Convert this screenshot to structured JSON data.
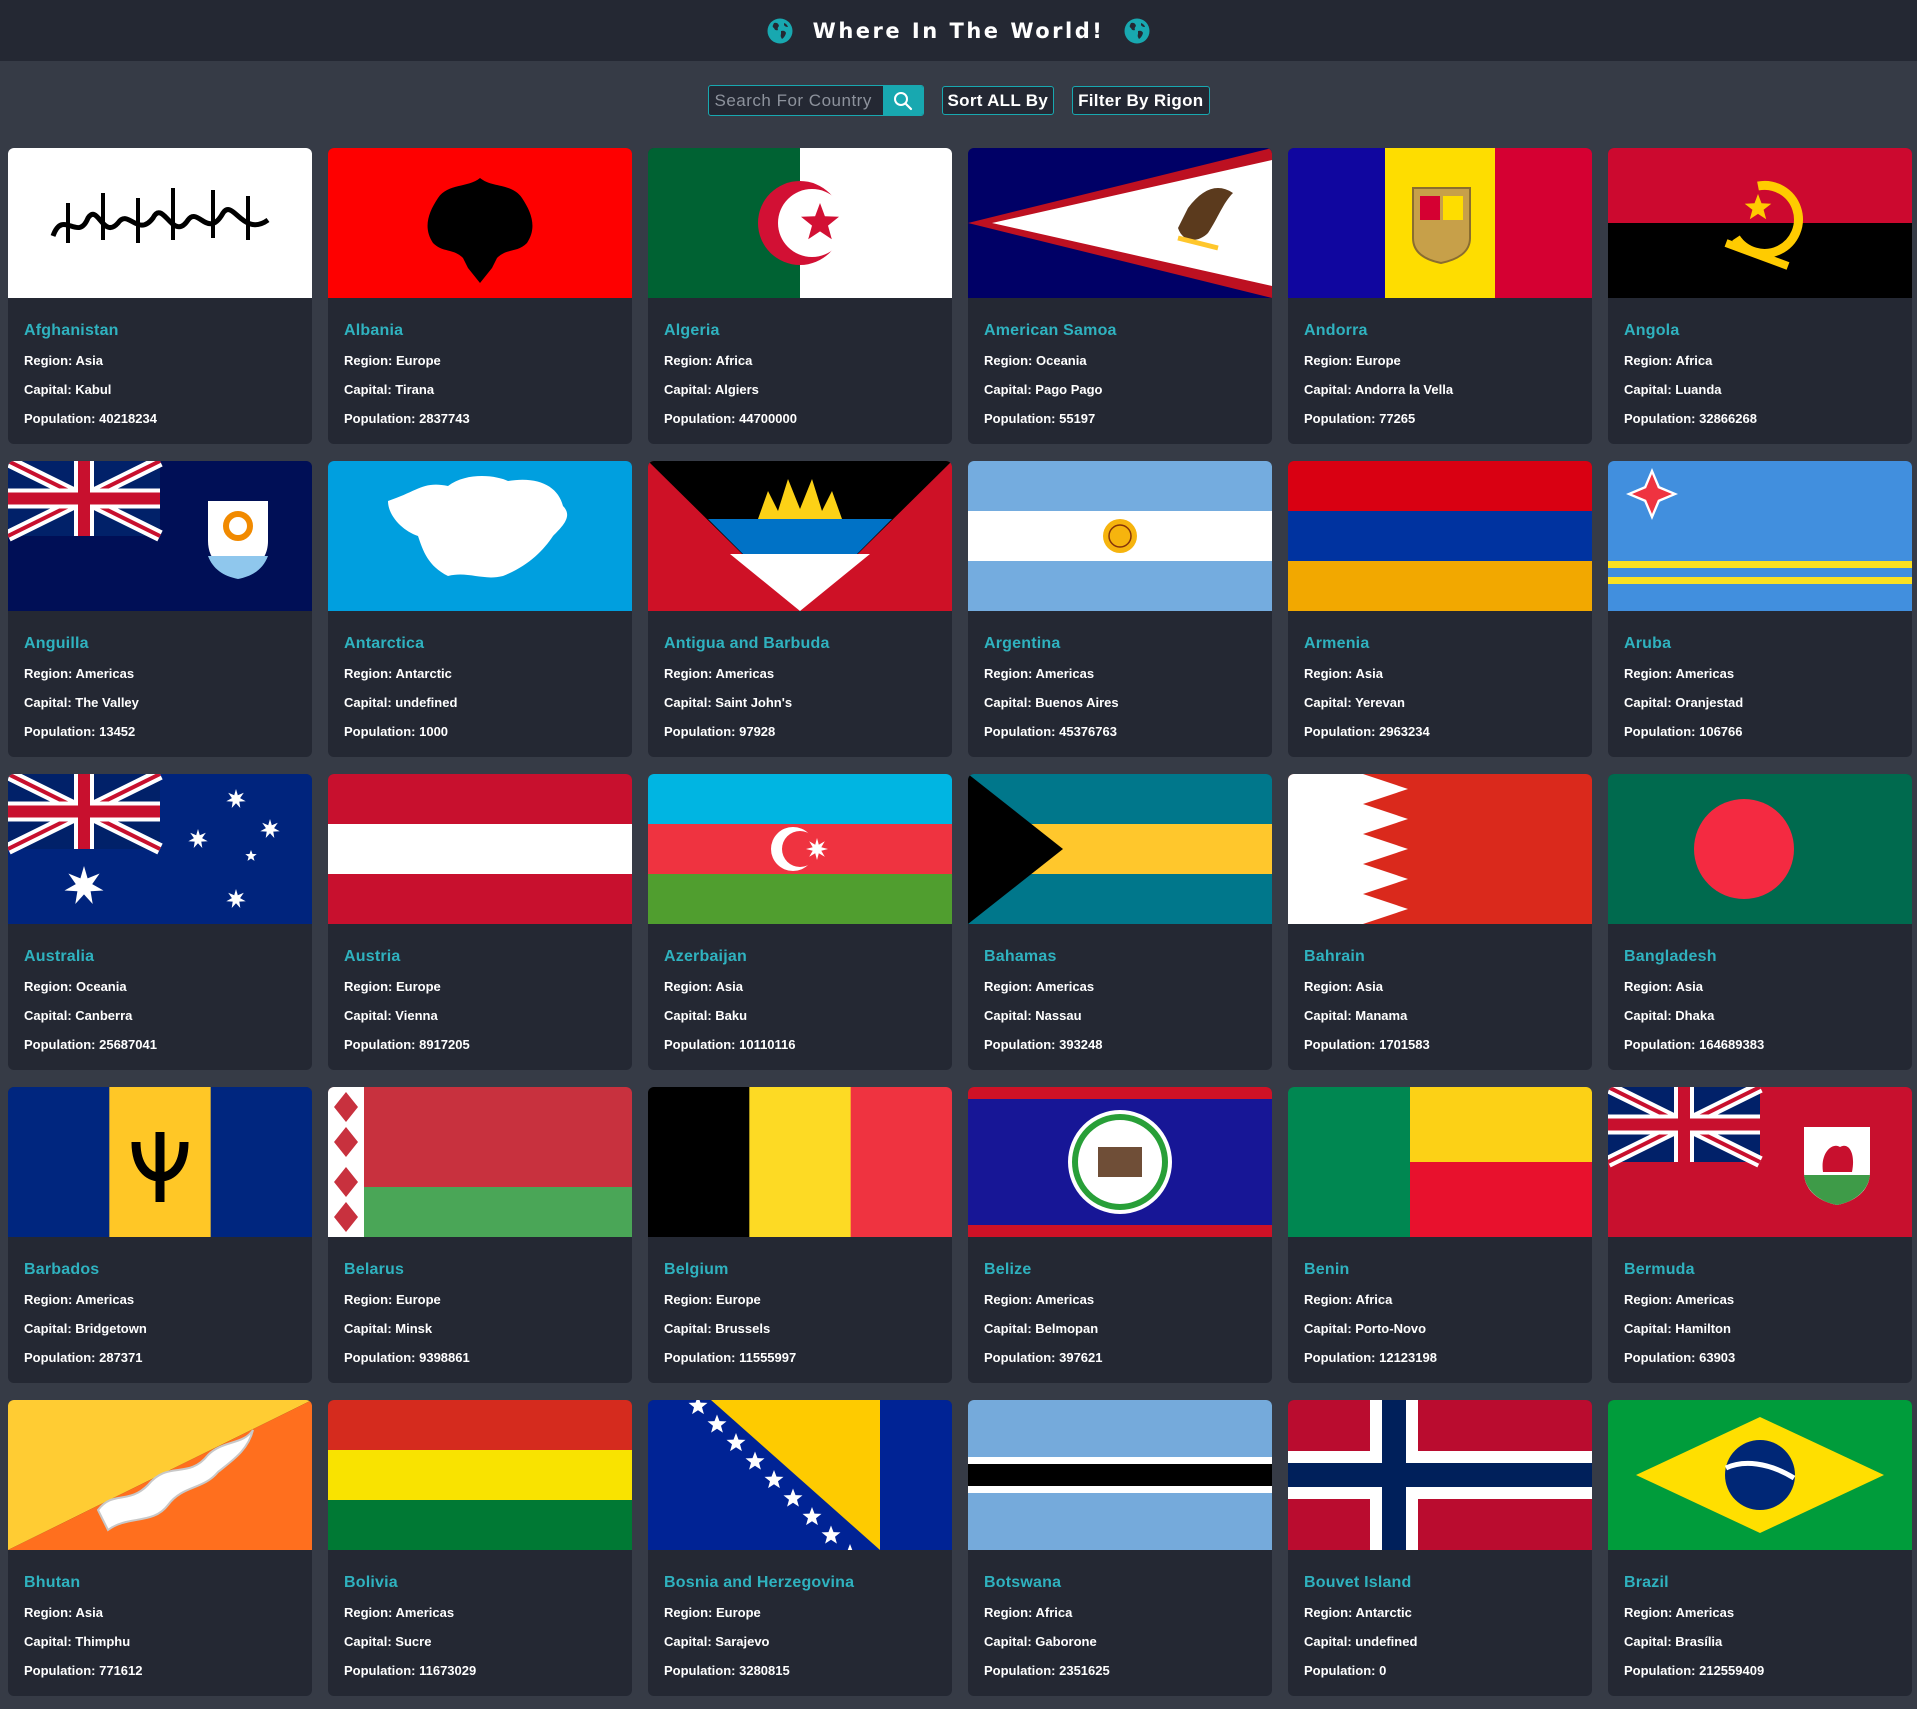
{
  "header": {
    "title": "Where In The World!"
  },
  "controls": {
    "search_placeholder": "Search For Country",
    "sort_label": "Sort ALL By",
    "filter_label": "Filter By Rigon"
  },
  "labels": {
    "region": "Region: ",
    "capital": "Capital: ",
    "population": "Population: "
  },
  "countries": [
    {
      "name": "Afghanistan",
      "region": "Asia",
      "capital": "Kabul",
      "population": "40218234",
      "flag": "afghanistan-flag"
    },
    {
      "name": "Albania",
      "region": "Europe",
      "capital": "Tirana",
      "population": "2837743",
      "flag": "albania-flag"
    },
    {
      "name": "Algeria",
      "region": "Africa",
      "capital": "Algiers",
      "population": "44700000",
      "flag": "algeria-flag"
    },
    {
      "name": "American Samoa",
      "region": "Oceania",
      "capital": "Pago Pago",
      "population": "55197",
      "flag": "american-samoa-flag"
    },
    {
      "name": "Andorra",
      "region": "Europe",
      "capital": "Andorra la Vella",
      "population": "77265",
      "flag": "andorra-flag"
    },
    {
      "name": "Angola",
      "region": "Africa",
      "capital": "Luanda",
      "population": "32866268",
      "flag": "angola-flag"
    },
    {
      "name": "Anguilla",
      "region": "Americas",
      "capital": "The Valley",
      "population": "13452",
      "flag": "anguilla-flag"
    },
    {
      "name": "Antarctica",
      "region": "Antarctic",
      "capital": "undefined",
      "population": "1000",
      "flag": "antarctica-flag"
    },
    {
      "name": "Antigua and Barbuda",
      "region": "Americas",
      "capital": "Saint John's",
      "population": "97928",
      "flag": "antigua-and-barbuda-flag"
    },
    {
      "name": "Argentina",
      "region": "Americas",
      "capital": "Buenos Aires",
      "population": "45376763",
      "flag": "argentina-flag"
    },
    {
      "name": "Armenia",
      "region": "Asia",
      "capital": "Yerevan",
      "population": "2963234",
      "flag": "armenia-flag"
    },
    {
      "name": "Aruba",
      "region": "Americas",
      "capital": "Oranjestad",
      "population": "106766",
      "flag": "aruba-flag"
    },
    {
      "name": "Australia",
      "region": "Oceania",
      "capital": "Canberra",
      "population": "25687041",
      "flag": "australia-flag"
    },
    {
      "name": "Austria",
      "region": "Europe",
      "capital": "Vienna",
      "population": "8917205",
      "flag": "austria-flag"
    },
    {
      "name": "Azerbaijan",
      "region": "Asia",
      "capital": "Baku",
      "population": "10110116",
      "flag": "azerbaijan-flag"
    },
    {
      "name": "Bahamas",
      "region": "Americas",
      "capital": "Nassau",
      "population": "393248",
      "flag": "bahamas-flag"
    },
    {
      "name": "Bahrain",
      "region": "Asia",
      "capital": "Manama",
      "population": "1701583",
      "flag": "bahrain-flag"
    },
    {
      "name": "Bangladesh",
      "region": "Asia",
      "capital": "Dhaka",
      "population": "164689383",
      "flag": "bangladesh-flag"
    },
    {
      "name": "Barbados",
      "region": "Americas",
      "capital": "Bridgetown",
      "population": "287371",
      "flag": "barbados-flag"
    },
    {
      "name": "Belarus",
      "region": "Europe",
      "capital": "Minsk",
      "population": "9398861",
      "flag": "belarus-flag"
    },
    {
      "name": "Belgium",
      "region": "Europe",
      "capital": "Brussels",
      "population": "11555997",
      "flag": "belgium-flag"
    },
    {
      "name": "Belize",
      "region": "Americas",
      "capital": "Belmopan",
      "population": "397621",
      "flag": "belize-flag"
    },
    {
      "name": "Benin",
      "region": "Africa",
      "capital": "Porto-Novo",
      "population": "12123198",
      "flag": "benin-flag"
    },
    {
      "name": "Bermuda",
      "region": "Americas",
      "capital": "Hamilton",
      "population": "63903",
      "flag": "bermuda-flag"
    },
    {
      "name": "Bhutan",
      "region": "Asia",
      "capital": "Thimphu",
      "population": "771612",
      "flag": "bhutan-flag"
    },
    {
      "name": "Bolivia",
      "region": "Americas",
      "capital": "Sucre",
      "population": "11673029",
      "flag": "bolivia-flag"
    },
    {
      "name": "Bosnia and Herzegovina",
      "region": "Europe",
      "capital": "Sarajevo",
      "population": "3280815",
      "flag": "bosnia-and-herzegovina-flag"
    },
    {
      "name": "Botswana",
      "region": "Africa",
      "capital": "Gaborone",
      "population": "2351625",
      "flag": "botswana-flag"
    },
    {
      "name": "Bouvet Island",
      "region": "Antarctic",
      "capital": "undefined",
      "population": "0",
      "flag": "bouvet-island-flag"
    },
    {
      "name": "Brazil",
      "region": "Americas",
      "capital": "Brasília",
      "population": "212559409",
      "flag": "brazil-flag"
    }
  ],
  "colors": {
    "accent": "#18a8b0",
    "name_text": "#2fb2bf",
    "card_bg": "#242833",
    "page_bg": "#363b46"
  }
}
